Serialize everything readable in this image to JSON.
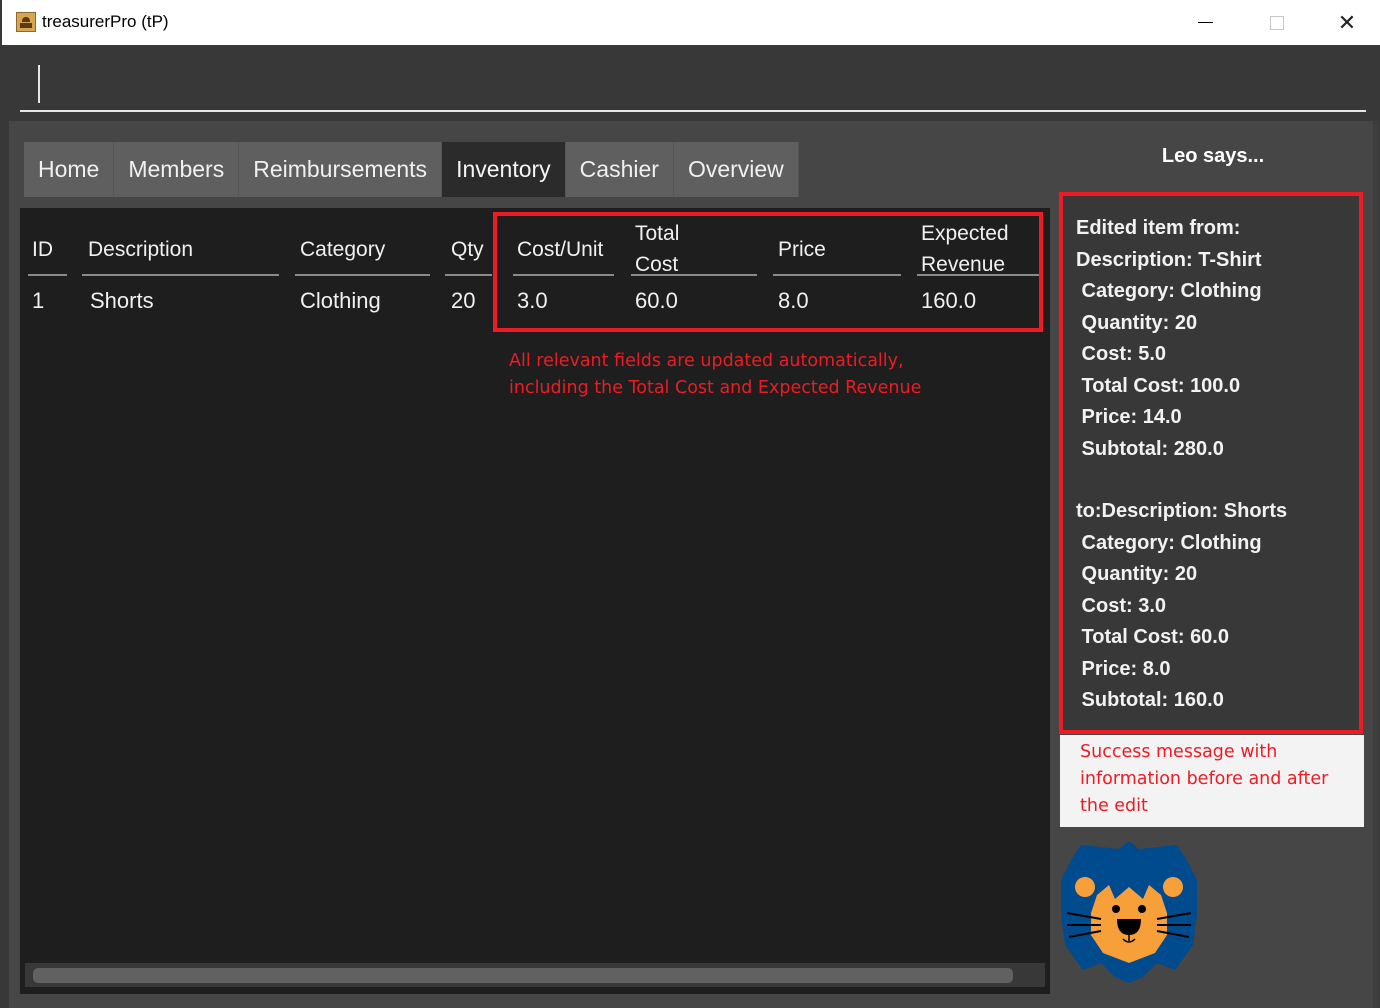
{
  "window": {
    "title": "treasurerPro (tP)",
    "controls": {
      "minimize": "minimize",
      "maximize": "maximize",
      "close": "✕"
    }
  },
  "command_box": {
    "value": "",
    "placeholder": ""
  },
  "tabs": [
    {
      "label": "Home",
      "active": false
    },
    {
      "label": "Members",
      "active": false
    },
    {
      "label": "Reimbursements",
      "active": false
    },
    {
      "label": "Inventory",
      "active": true
    },
    {
      "label": "Cashier",
      "active": false
    },
    {
      "label": "Overview",
      "active": false
    }
  ],
  "inventory_table": {
    "columns": [
      "ID",
      "Description",
      "Category",
      "Qty",
      "Cost/Unit",
      "Total\nCost",
      "Price",
      "Expected\nRevenue"
    ],
    "column_lines": [
      [
        "ID"
      ],
      [
        "Description"
      ],
      [
        "Category"
      ],
      [
        "Qty"
      ],
      [
        "Cost/Unit"
      ],
      [
        "Total",
        "Cost"
      ],
      [
        "Price"
      ],
      [
        "Expected",
        "Revenue"
      ]
    ],
    "rows": [
      [
        "1",
        "Shorts",
        "Clothing",
        "20",
        "3.0",
        "60.0",
        "8.0",
        "160.0"
      ]
    ]
  },
  "annotations": {
    "table_note": [
      "All relevant fields are updated automatically,",
      "including the Total Cost and Expected Revenue"
    ],
    "message_note": [
      "Success message with",
      "information before and after",
      "the edit"
    ],
    "highlight_color": "#ed1c24"
  },
  "assistant": {
    "title": "Leo says...",
    "message_before": [
      "Edited item from:",
      "Description: T-Shirt",
      " Category: Clothing",
      " Quantity: 20",
      " Cost: 5.0",
      " Total Cost: 100.0",
      " Price: 14.0",
      " Subtotal: 280.0"
    ],
    "message_after": [
      "to:Description: Shorts",
      " Category: Clothing",
      " Quantity: 20",
      " Cost: 3.0",
      " Total Cost: 60.0",
      " Price: 8.0",
      " Subtotal: 160.0"
    ],
    "mascot": "lion-mascot-icon",
    "mascot_colors": {
      "mane": "#004b8d",
      "face": "#f7a03a"
    }
  }
}
